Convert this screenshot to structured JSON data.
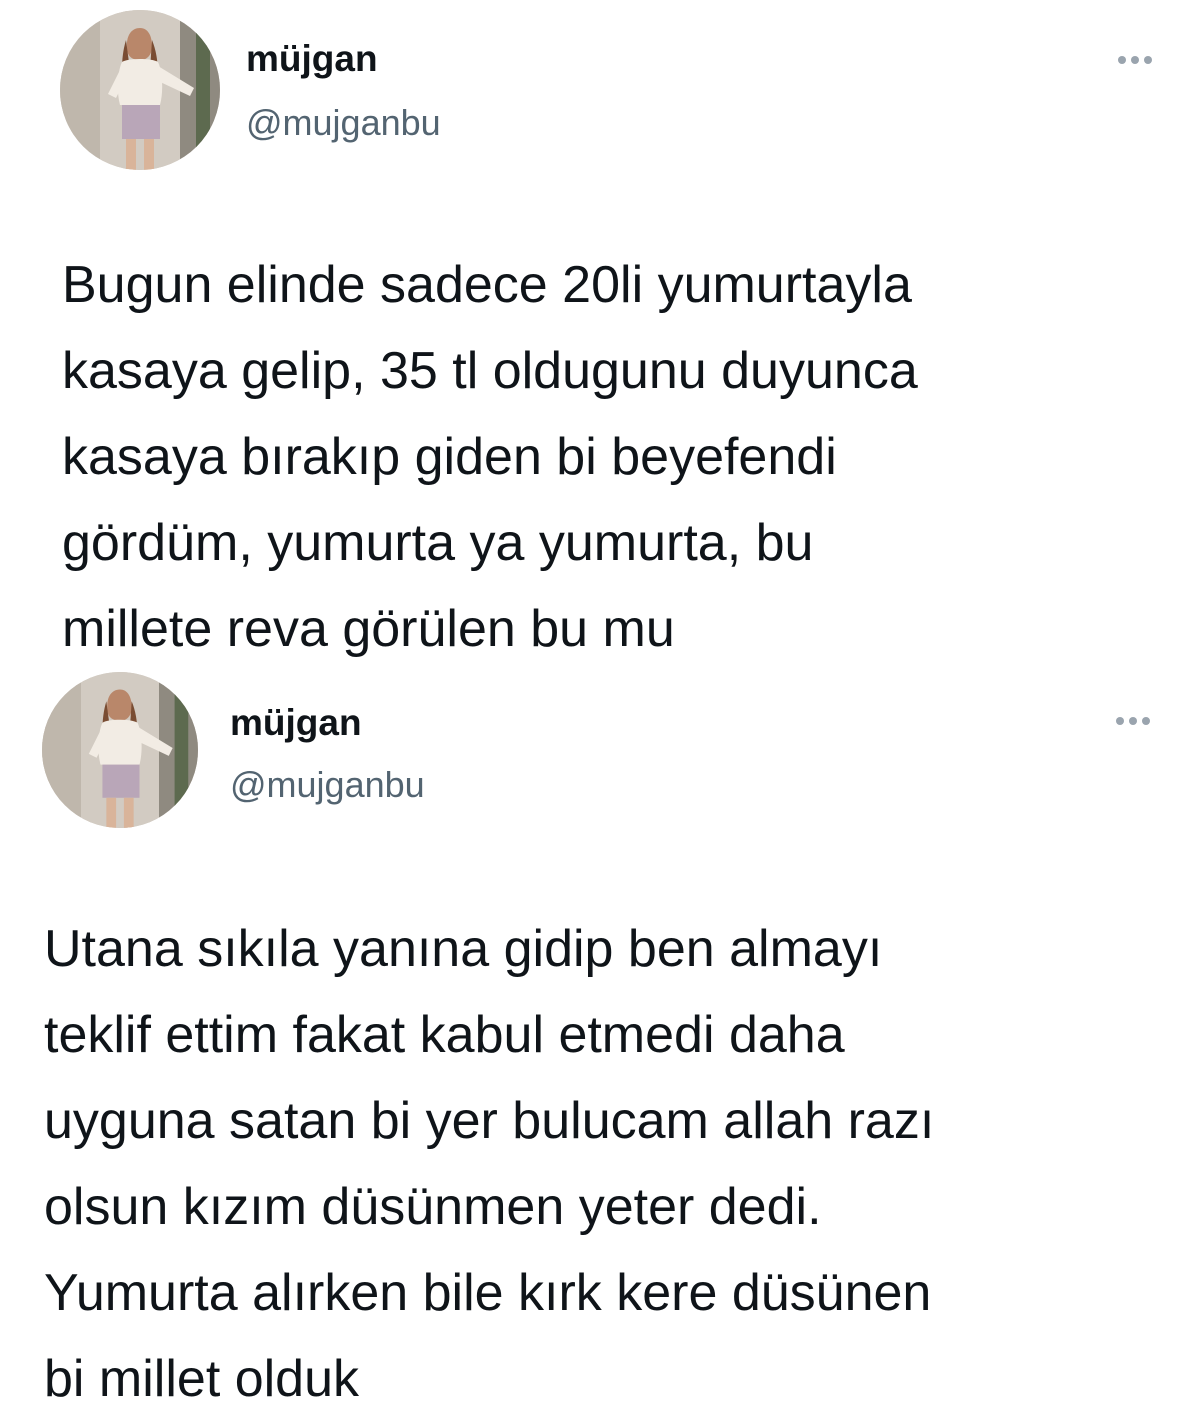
{
  "tweets": [
    {
      "author": {
        "name": "müjgan",
        "handle": "@mujganbu",
        "avatar": "profile-photo-avatar"
      },
      "more_icon": "more-horizontal-icon",
      "text_lines": [
        "Bugun elinde sadece 20li yumurtayla",
        "kasaya gelip, 35 tl oldugunu duyunca",
        "kasaya bırakıp giden bi beyefendi",
        "gördüm, yumurta ya yumurta, bu",
        "millete reva görülen bu mu"
      ]
    },
    {
      "author": {
        "name": "müjgan",
        "handle": "@mujganbu",
        "avatar": "profile-photo-avatar"
      },
      "more_icon": "more-horizontal-icon",
      "text_lines": [
        "Utana sıkıla yanına gidip ben almayı",
        "teklif ettim fakat kabul etmedi daha",
        "uyguna satan bi yer bulucam allah razı",
        "olsun kızım düsünmen yeter dedi.",
        "Yumurta alırken bile kırk kere düsünen",
        "bi millet olduk"
      ]
    }
  ],
  "colors": {
    "text_primary": "#0f1419",
    "text_secondary": "#536471",
    "more_dots": "#9aa4ae",
    "background": "#ffffff"
  }
}
